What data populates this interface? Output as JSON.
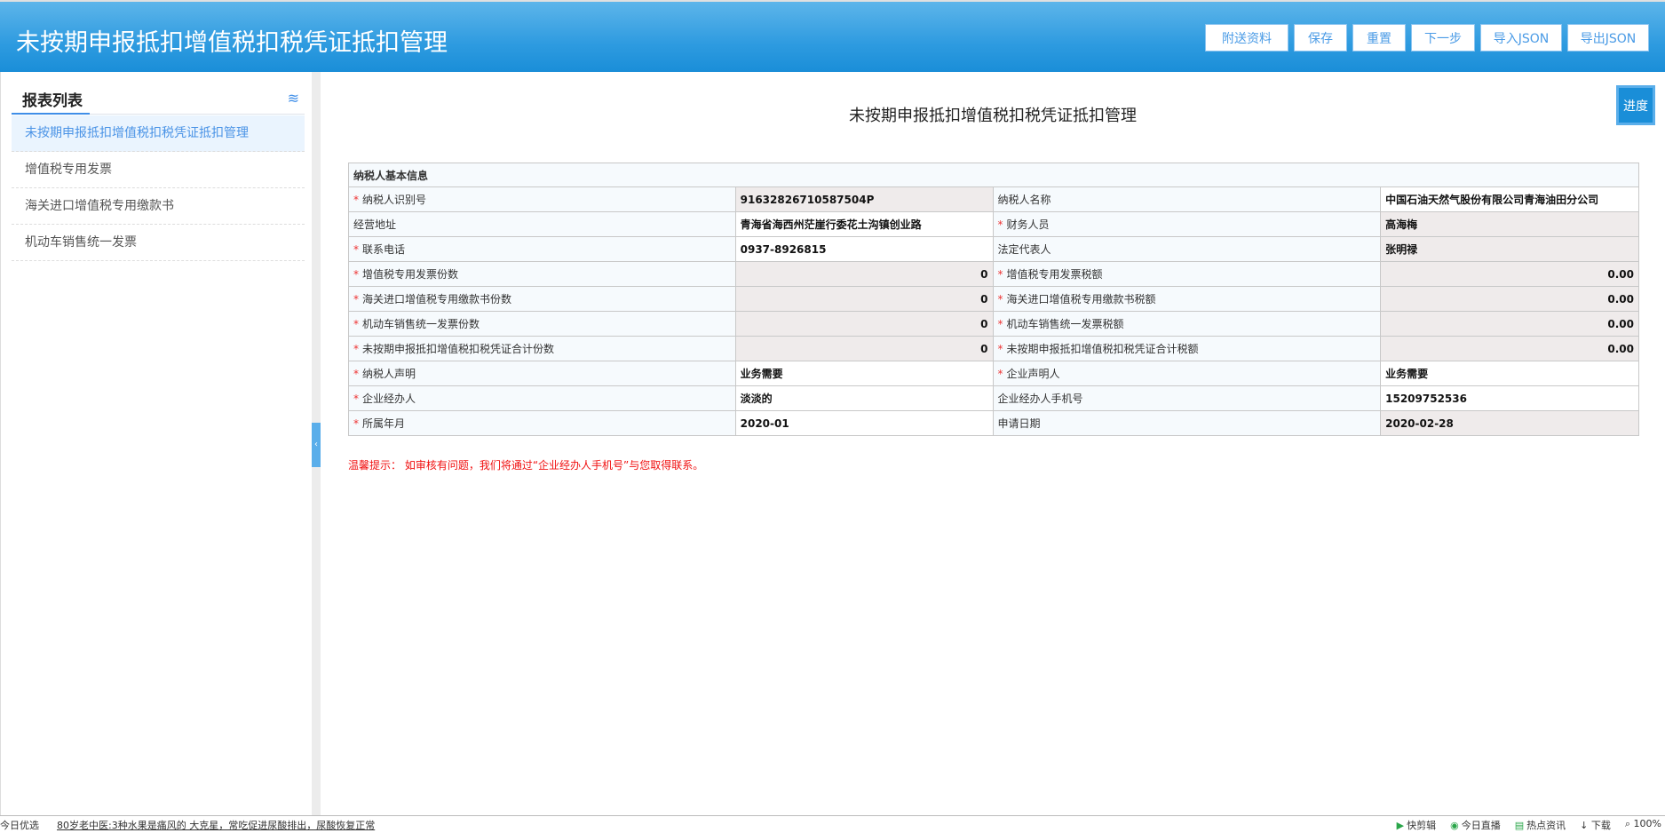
{
  "header": {
    "title": "未按期申报抵扣增值税扣税凭证抵扣管理",
    "buttons": [
      "附送资料",
      "保存",
      "重置",
      "下一步",
      "导入JSON",
      "导出JSON"
    ]
  },
  "sidebar": {
    "title": "报表列表",
    "items": [
      "未按期申报抵扣增值税扣税凭证抵扣管理",
      "增值税专用发票",
      "海关进口增值税专用缴款书",
      "机动车销售统一发票"
    ]
  },
  "main": {
    "title": "未按期申报抵扣增值税扣税凭证抵扣管理",
    "progress_label": "进度",
    "section": "纳税人基本信息",
    "rows": [
      {
        "l1": "纳税人识别号",
        "r1": true,
        "v1": "91632826710587504P",
        "l2": "纳税人名称",
        "r2": false,
        "v2": "中国石油天然气股份有限公司青海油田分公司"
      },
      {
        "l1": "经营地址",
        "r1": false,
        "v1": "青海省海西州茫崖行委花土沟镇创业路",
        "l2": "财务人员",
        "r2": true,
        "v2": "高海梅"
      },
      {
        "l1": "联系电话",
        "r1": true,
        "v1": "0937-8926815",
        "l2": "法定代表人",
        "r2": false,
        "v2": "张明禄"
      },
      {
        "l1": "增值税专用发票份数",
        "r1": true,
        "v1": "0",
        "l2": "增值税专用发票税额",
        "r2": true,
        "v2": "0.00"
      },
      {
        "l1": "海关进口增值税专用缴款书份数",
        "r1": true,
        "v1": "0",
        "l2": "海关进口增值税专用缴款书税额",
        "r2": true,
        "v2": "0.00"
      },
      {
        "l1": "机动车销售统一发票份数",
        "r1": true,
        "v1": "0",
        "l2": "机动车销售统一发票税额",
        "r2": true,
        "v2": "0.00"
      },
      {
        "l1": "未按期申报抵扣增值税扣税凭证合计份数",
        "r1": true,
        "v1": "0",
        "l2": "未按期申报抵扣增值税扣税凭证合计税额",
        "r2": true,
        "v2": "0.00"
      },
      {
        "l1": "纳税人声明",
        "r1": true,
        "v1": "业务需要",
        "l2": "企业声明人",
        "r2": true,
        "v2": "业务需要"
      },
      {
        "l1": "企业经办人",
        "r1": true,
        "v1": "淡淡的",
        "l2": "企业经办人手机号",
        "r2": false,
        "v2": "15209752536"
      },
      {
        "l1": "所属年月",
        "r1": true,
        "v1": "2020-01",
        "l2": "申请日期",
        "r2": false,
        "v2": "2020-02-28"
      }
    ],
    "tip": "温馨提示： 如审核有问题，我们将通过“企业经办人手机号”与您取得联系。"
  },
  "statusbar": {
    "left": "今日优选",
    "news": "80岁老中医:3种水果是痛风的 大克星，常吃促进尿酸排出，尿酸恢复正常",
    "right": [
      "快剪辑",
      "今日直播",
      "热点资讯",
      "下载",
      "100%"
    ]
  }
}
